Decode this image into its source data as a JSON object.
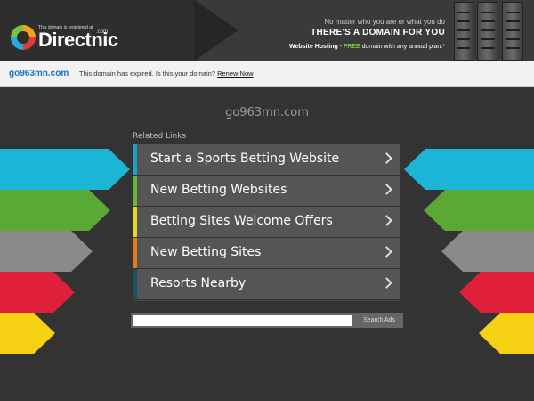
{
  "header": {
    "registered_text": "This domain is registered at",
    "brand_name": "Directnic",
    "brand_suffix": ".com",
    "tagline_line1": "No matter who you are or what you do",
    "tagline_line2": "THERE'S A DOMAIN FOR YOU",
    "tagline_line3_bold": "Website Hosting",
    "tagline_line3_sep": " - ",
    "tagline_line3_free": "FREE",
    "tagline_line3_rest": " domain with any annual plan.*"
  },
  "notice": {
    "domain": "go963mn.com",
    "message": "This domain has expired. Is this your domain?",
    "renew_label": "Renew Now"
  },
  "main": {
    "site_title": "go963mn.com",
    "related_heading": "Related Links",
    "links": [
      {
        "label": "Start a Sports Betting Website",
        "color": "#1ba3c4"
      },
      {
        "label": "New Betting Websites",
        "color": "#6cb33f"
      },
      {
        "label": "Betting Sites Welcome Offers",
        "color": "#e3d82b"
      },
      {
        "label": "New Betting Sites",
        "color": "#e57d1f"
      },
      {
        "label": "Resorts Nearby",
        "color": "#1a4f62"
      }
    ]
  },
  "search": {
    "placeholder": "",
    "button_label": "Search Ads"
  },
  "colors": {
    "arrow_cyan": "#1bb5d6",
    "arrow_green": "#5aa836",
    "arrow_gray": "#8a8a8a",
    "arrow_red": "#e0203a",
    "arrow_yellow": "#f6d114"
  }
}
